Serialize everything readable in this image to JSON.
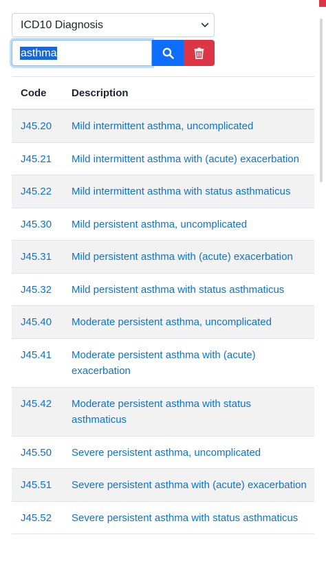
{
  "select": {
    "value": "ICD10 Diagnosis"
  },
  "search": {
    "value": "asthma"
  },
  "table": {
    "headers": {
      "code": "Code",
      "description": "Description"
    },
    "rows": [
      {
        "code": "J45.20",
        "description": "Mild intermittent asthma, uncomplicated"
      },
      {
        "code": "J45.21",
        "description": "Mild intermittent asthma with (acute) exacerbation"
      },
      {
        "code": "J45.22",
        "description": "Mild intermittent asthma with status asthmaticus"
      },
      {
        "code": "J45.30",
        "description": "Mild persistent asthma, uncomplicated"
      },
      {
        "code": "J45.31",
        "description": "Mild persistent asthma with (acute) exacerbation"
      },
      {
        "code": "J45.32",
        "description": "Mild persistent asthma with status asthmaticus"
      },
      {
        "code": "J45.40",
        "description": "Moderate persistent asthma, uncomplicated"
      },
      {
        "code": "J45.41",
        "description": "Moderate persistent asthma with (acute) exacerbation"
      },
      {
        "code": "J45.42",
        "description": "Moderate persistent asthma with status asthmaticus"
      },
      {
        "code": "J45.50",
        "description": "Severe persistent asthma, uncomplicated"
      },
      {
        "code": "J45.51",
        "description": "Severe persistent asthma with (acute) exacerbation"
      },
      {
        "code": "J45.52",
        "description": "Severe persistent asthma with status asthmaticus"
      }
    ]
  },
  "icons": {
    "select_arrow": "chevron-down-icon",
    "search_button": "search-icon",
    "delete_button": "trash-icon"
  },
  "colors": {
    "primary": "#0d6efd",
    "danger": "#dc3545",
    "link": "#0b72d6",
    "stripe": "#f2f2f2"
  }
}
